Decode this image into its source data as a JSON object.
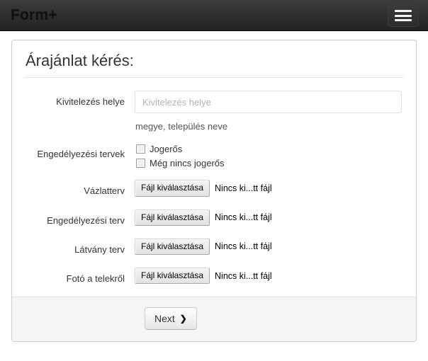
{
  "navbar": {
    "brand": "Form+",
    "toggle_icon": "hamburger-menu-icon"
  },
  "panel": {
    "title": "Árajánlat kérés:",
    "fields": {
      "location": {
        "label": "Kivitelezés helye",
        "placeholder": "Kivitelezés helye",
        "value": "",
        "help": "megye, település neve"
      },
      "permits": {
        "label": "Engedélyezési tervek",
        "options": [
          {
            "label": "Jogerős",
            "checked": false
          },
          {
            "label": "Még nincs jogerős",
            "checked": false
          }
        ]
      }
    },
    "file_rows": [
      {
        "label": "Vázlatterv",
        "button": "Fájl kiválasztása",
        "status": "Nincs ki...tt fájl"
      },
      {
        "label": "Engedélyezési terv",
        "button": "Fájl kiválasztása",
        "status": "Nincs ki...tt fájl"
      },
      {
        "label": "Látvány terv",
        "button": "Fájl kiválasztása",
        "status": "Nincs ki...tt fájl"
      },
      {
        "label": "Fotó a telekről",
        "button": "Fájl kiválasztása",
        "status": "Nincs ki...tt fájl"
      }
    ],
    "footer": {
      "next_label": "Next",
      "next_icon": "chevron-right-icon",
      "next_glyph": "❯"
    }
  },
  "colors": {
    "navbar_bg": "#222222",
    "panel_border": "#cccccc",
    "footer_bg": "#f5f5f5",
    "text": "#333333",
    "placeholder": "#b3b3b3"
  }
}
